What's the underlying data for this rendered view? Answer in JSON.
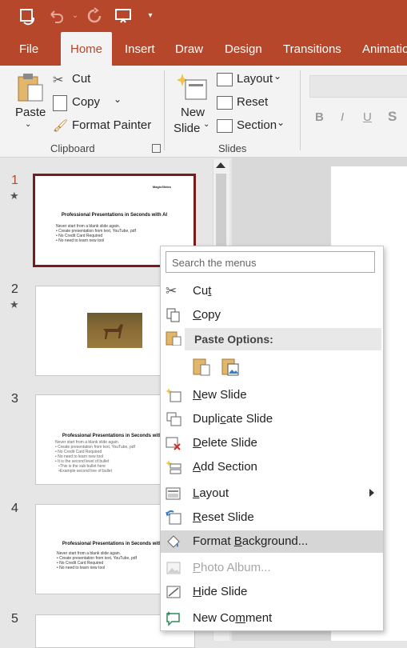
{
  "qat": {
    "icons": [
      "autosave-icon",
      "undo-icon",
      "redo-icon",
      "slideshow-icon",
      "customize-icon"
    ]
  },
  "tabs": [
    "File",
    "Home",
    "Insert",
    "Draw",
    "Design",
    "Transitions",
    "Animatio"
  ],
  "active_tab": "Home",
  "ribbon": {
    "paste_label": "Paste",
    "cut_label": "Cut",
    "copy_label": "Copy",
    "format_painter_label": "Format Painter",
    "clipboard_group": "Clipboard",
    "new_slide_label1": "New",
    "new_slide_label2": "Slide",
    "layout_label": "Layout",
    "reset_label": "Reset",
    "section_label": "Section",
    "slides_group": "Slides",
    "font_buttons": [
      "B",
      "I",
      "U",
      "S"
    ]
  },
  "slides": [
    {
      "num": "1",
      "title": "Professional Presentations in Seconds with AI",
      "body": "Never start from a blank slide again.\n• Create presentation from text, YouTube, pdf\n• No Credit Card Required\n• No need to learn new tool",
      "logo": "MagicSlides"
    },
    {
      "num": "2"
    },
    {
      "num": "3",
      "title": "Professional Presentations in Seconds with AI",
      "body": "Never start from a blank slide again.\n• Create presentation from text, YouTube, pdf\n• No Credit Card Required\n• No need to learn new tool\n• It is the second level of bullet\n   •This is the sub bullet here\n   •Example second line of bullet"
    },
    {
      "num": "4",
      "title": "Professional Presentations in Seconds with AI",
      "body": "Never start from a blank slide again.\n• Create presentation from text, YouTube, pdf\n• No Credit Card Required\n• No need to learn new tool"
    },
    {
      "num": "5"
    }
  ],
  "menu": {
    "search_placeholder": "Search the menus",
    "paste_options_header": "Paste Options:",
    "items": {
      "cut": "Cut",
      "copy": "Copy",
      "new_slide": "New Slide",
      "duplicate_slide": "Duplicate Slide",
      "delete_slide": "Delete Slide",
      "add_section": "Add Section",
      "layout": "Layout",
      "reset_slide": "Reset Slide",
      "format_background": "Format Background...",
      "photo_album": "Photo Album...",
      "hide_slide": "Hide Slide",
      "new_comment": "New Comment"
    }
  },
  "colors": {
    "accent": "#b7472a",
    "selected_border": "#7b1a1a",
    "highlight": "#d6d6d6"
  }
}
